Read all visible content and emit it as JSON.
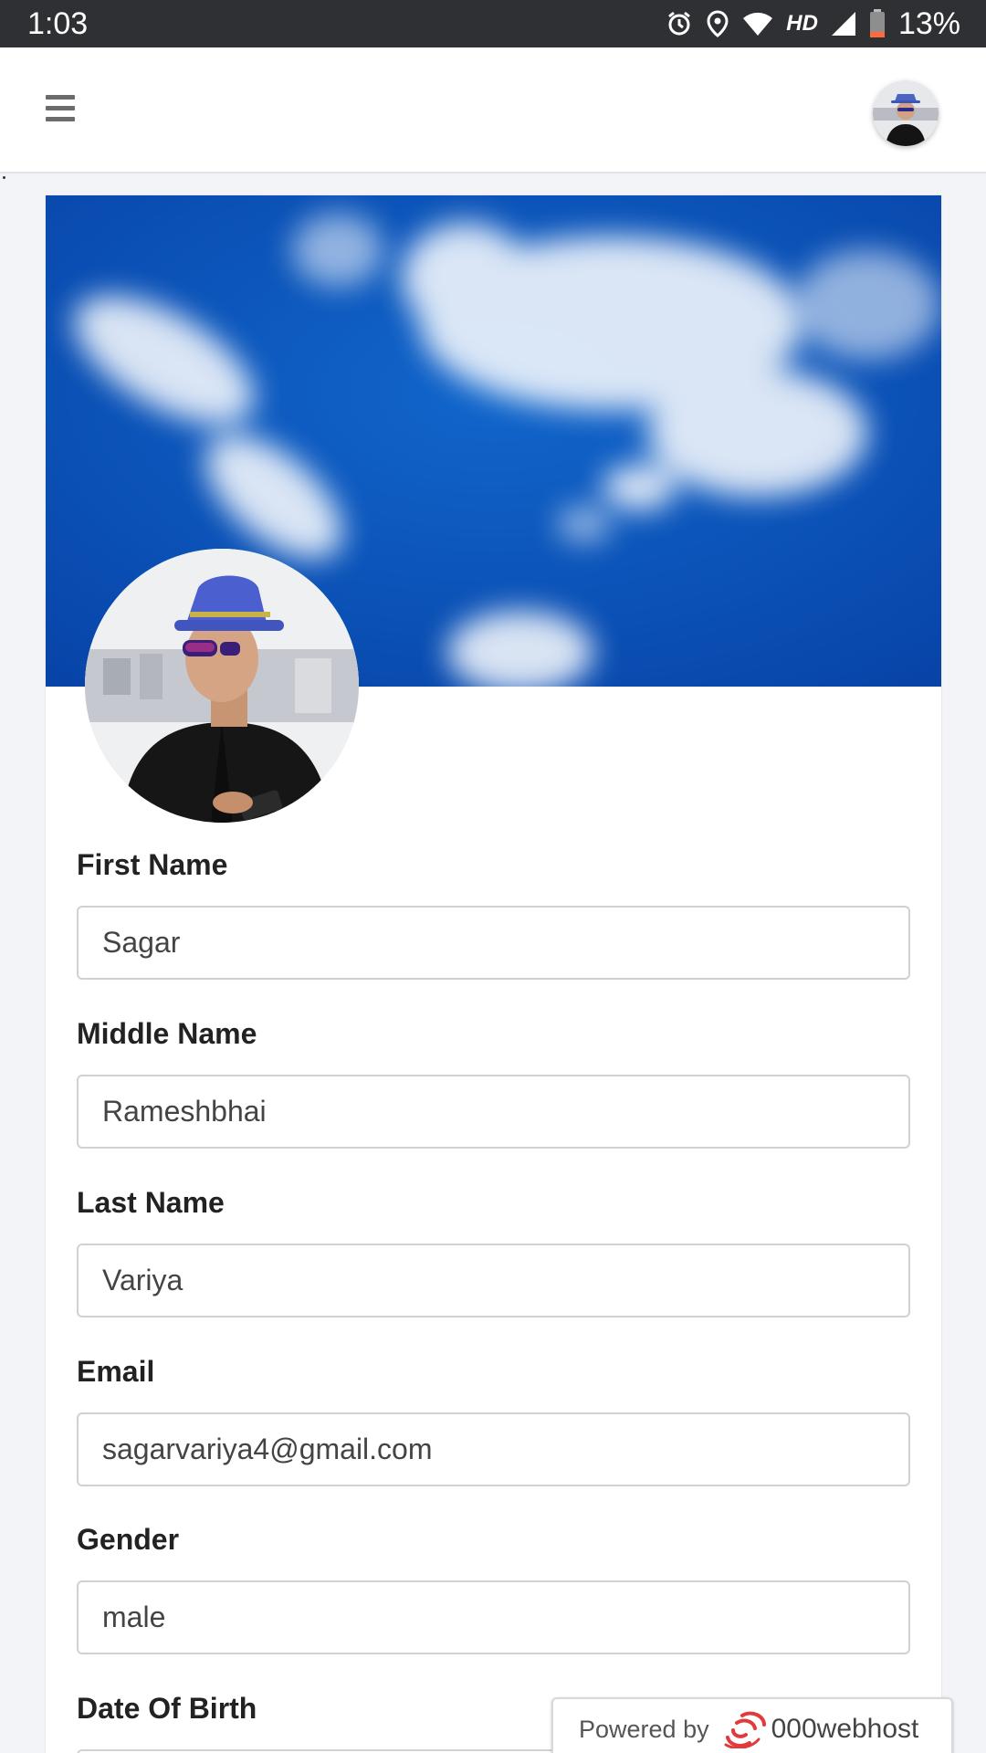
{
  "status_bar": {
    "time": "1:03",
    "network": "HD",
    "battery": "13%",
    "icons": [
      "alarm-icon",
      "location-icon",
      "wifi-icon",
      "signal-icon",
      "battery-icon"
    ]
  },
  "app_bar": {
    "menu_icon": "hamburger-menu-icon",
    "avatar": "user-avatar"
  },
  "profile": {
    "fields": [
      {
        "label": "First Name",
        "value": "Sagar"
      },
      {
        "label": "Middle Name",
        "value": "Rameshbhai"
      },
      {
        "label": "Last Name",
        "value": "Variya"
      },
      {
        "label": "Email",
        "value": "sagarvariya4@gmail.com"
      },
      {
        "label": "Gender",
        "value": "male"
      },
      {
        "label": "Date Of Birth",
        "value": ""
      }
    ]
  },
  "footer_badge": {
    "prefix": "Powered by",
    "brand": "000webhost"
  },
  "colors": {
    "status_bar_bg": "#2f3034",
    "sky_blue": "#0a4fb8",
    "page_bg": "#f3f4f8",
    "brand_red": "#e23a3a"
  }
}
